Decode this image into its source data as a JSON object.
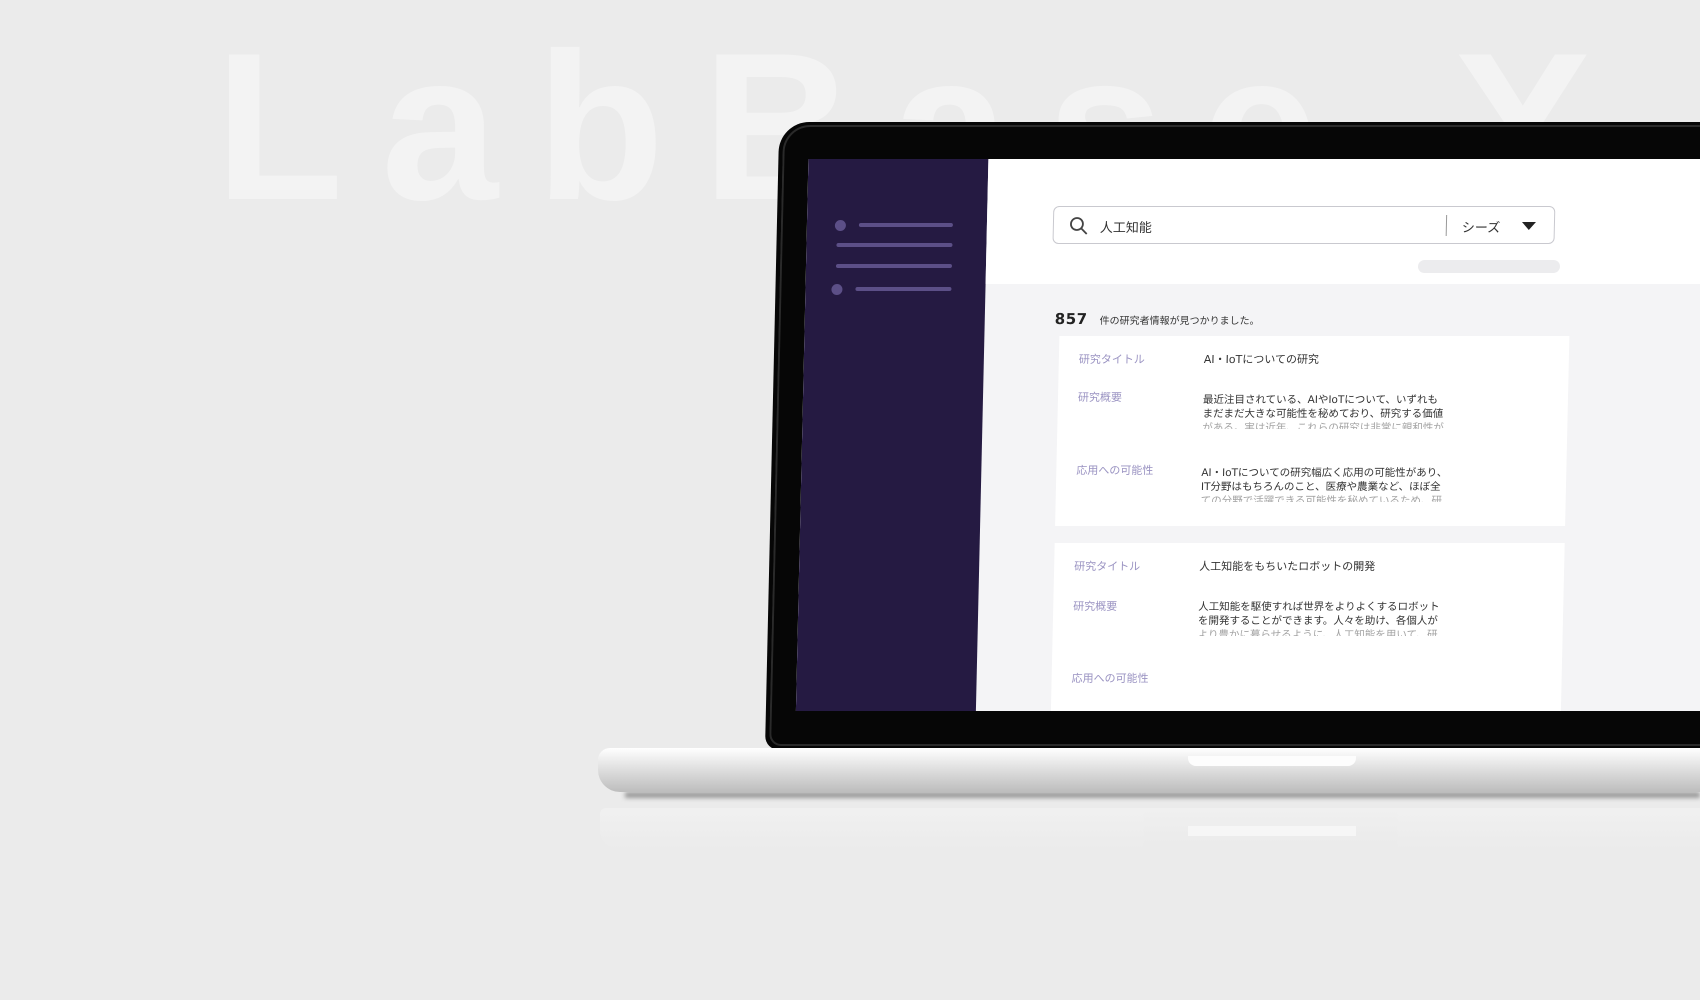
{
  "brand": {
    "watermark": "LabBase X"
  },
  "sidebar": {
    "menu_lines": 4
  },
  "search": {
    "query": "人工知能",
    "category": "シーズ"
  },
  "results": {
    "count": "857",
    "count_suffix": "件の研究者情報が見つかりました。",
    "cards": [
      {
        "title_label": "研究タイトル",
        "title": "AI・IoTについての研究",
        "summary_label": "研究概要",
        "summary_lines": [
          "最近注目されている、AIやIoTについて、いずれも",
          "まだまだ大きな可能性を秘めており、研究する価値",
          "がある。実は近年、これらの研究は非常に親和性が"
        ],
        "application_label": "応用への可能性",
        "application_lines": [
          "AI・IoTについての研究幅広く応用の可能性があり、",
          "IT分野はもちろんのこと、医療や農業など、ほぼ全",
          "ての分野で活躍できる可能性を秘めているため、研"
        ]
      },
      {
        "title_label": "研究タイトル",
        "title": "人工知能をもちいたロボットの開発",
        "summary_label": "研究概要",
        "summary_lines": [
          "人工知能を駆使すれば世界をよりよくするロボット",
          "を開発することができます。人々を助け、各個人が",
          "より豊かに暮らせるように、人工知能を用いて、研"
        ],
        "application_label": "応用への可能性"
      }
    ]
  }
}
